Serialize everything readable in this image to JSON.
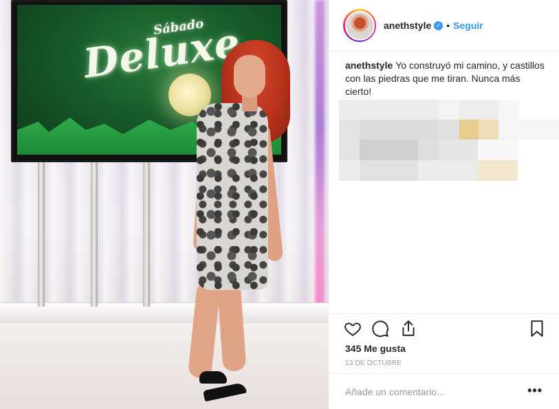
{
  "photo": {
    "tv_logo_small": "Sábado",
    "tv_logo_large": "Deluxe"
  },
  "header": {
    "username": "anethstyle",
    "separator": "•",
    "follow_label": "Seguir",
    "verified_icon": "verified-badge-icon"
  },
  "caption": {
    "username": "anethstyle",
    "text": "Yo construyó mi camino, y castillos con las piedras que me tiran. Nunca más cierto!"
  },
  "actions": {
    "icons": [
      "heart-icon",
      "comment-icon",
      "share-icon",
      "bookmark-icon"
    ]
  },
  "likes": {
    "text": "345 Me gusta"
  },
  "date": {
    "text": "13 DE OCTUBRE"
  },
  "comment": {
    "placeholder": "Añade un comentario...",
    "more_label": "•••"
  },
  "colors": {
    "link_blue": "#3897f0",
    "text_primary": "#262626",
    "text_secondary": "#999999",
    "divider": "#efefef"
  }
}
